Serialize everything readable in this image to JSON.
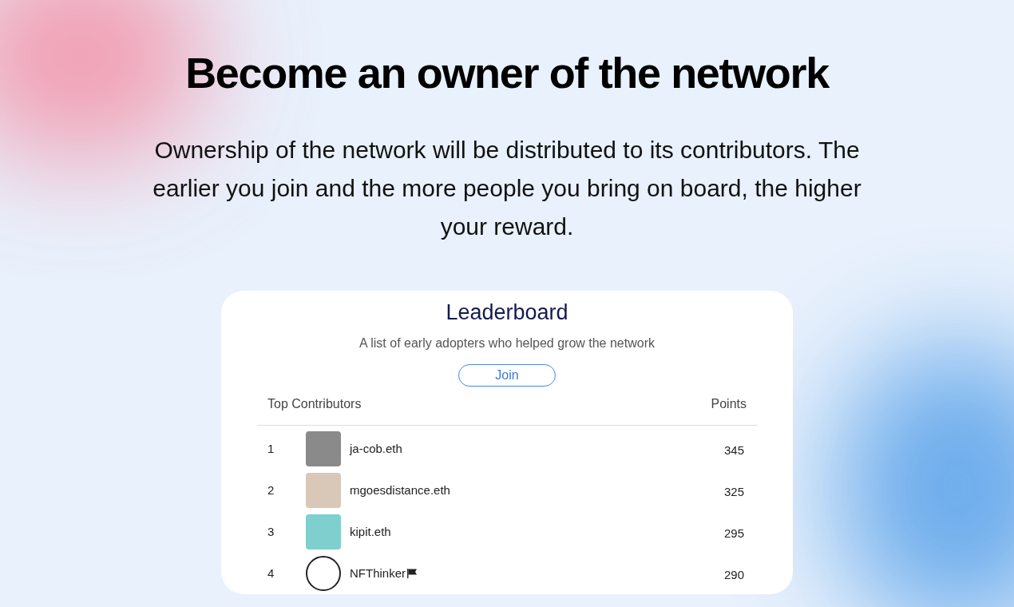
{
  "hero": {
    "title": "Become an owner of the network",
    "text": "Ownership of the network will be distributed to its contributors. The earlier you join and the more people you bring on board, the higher your reward."
  },
  "leaderboard": {
    "title": "Leaderboard",
    "subtitle": "A list of early adopters who helped grow the network",
    "join_button": "Join",
    "columns": [
      "Top Contributors",
      "Points"
    ],
    "rows": [
      {
        "rank": "1",
        "name": "ja-cob.eth",
        "points": "345",
        "flag": false
      },
      {
        "rank": "2",
        "name": "mgoesdistance.eth",
        "points": "325",
        "flag": false
      },
      {
        "rank": "3",
        "name": "kipit.eth",
        "points": "295",
        "flag": false
      },
      {
        "rank": "4",
        "name": "NFThinker",
        "points": "290",
        "flag": true
      }
    ]
  }
}
